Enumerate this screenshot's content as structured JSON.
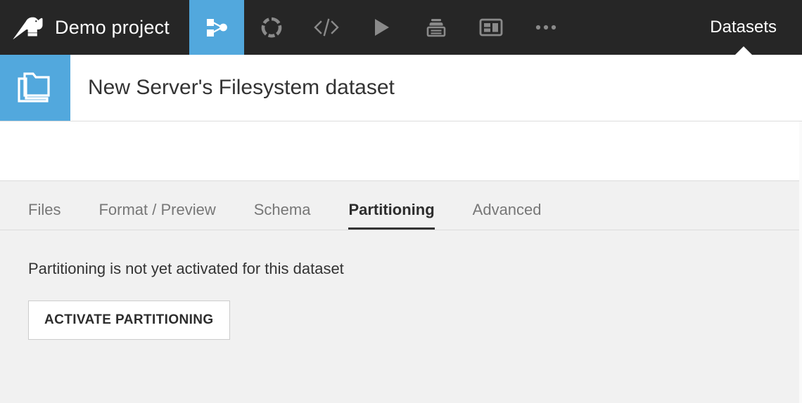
{
  "topnav": {
    "logo_icon": "dataiku-bird-logo",
    "project_name": "Demo project",
    "icons": [
      {
        "name": "flow-icon",
        "label": "Flow",
        "active": true
      },
      {
        "name": "lab-icon",
        "label": "Lab",
        "active": false
      },
      {
        "name": "code-icon",
        "label": "Code",
        "active": false
      },
      {
        "name": "run-icon",
        "label": "Run",
        "active": false
      },
      {
        "name": "jobs-icon",
        "label": "Jobs",
        "active": false
      },
      {
        "name": "dashboard-icon",
        "label": "Dashboards",
        "active": false
      },
      {
        "name": "more-icon",
        "label": "More",
        "active": false
      }
    ],
    "right_label": "Datasets"
  },
  "dataset_header": {
    "icon": "folder-stack-icon",
    "title": "New Server's Filesystem dataset"
  },
  "tabs": [
    {
      "label": "Files",
      "active": false
    },
    {
      "label": "Format / Preview",
      "active": false
    },
    {
      "label": "Schema",
      "active": false
    },
    {
      "label": "Partitioning",
      "active": true
    },
    {
      "label": "Advanced",
      "active": false
    }
  ],
  "content": {
    "notice": "Partitioning is not yet activated for this dataset",
    "activate_button": "ACTIVATE PARTITIONING"
  },
  "colors": {
    "nav_background": "#262626",
    "accent_blue": "#52a8dd",
    "content_background": "#f1f1f1",
    "active_tab_underline": "#333333",
    "icon_gray": "#8a8a8a"
  }
}
